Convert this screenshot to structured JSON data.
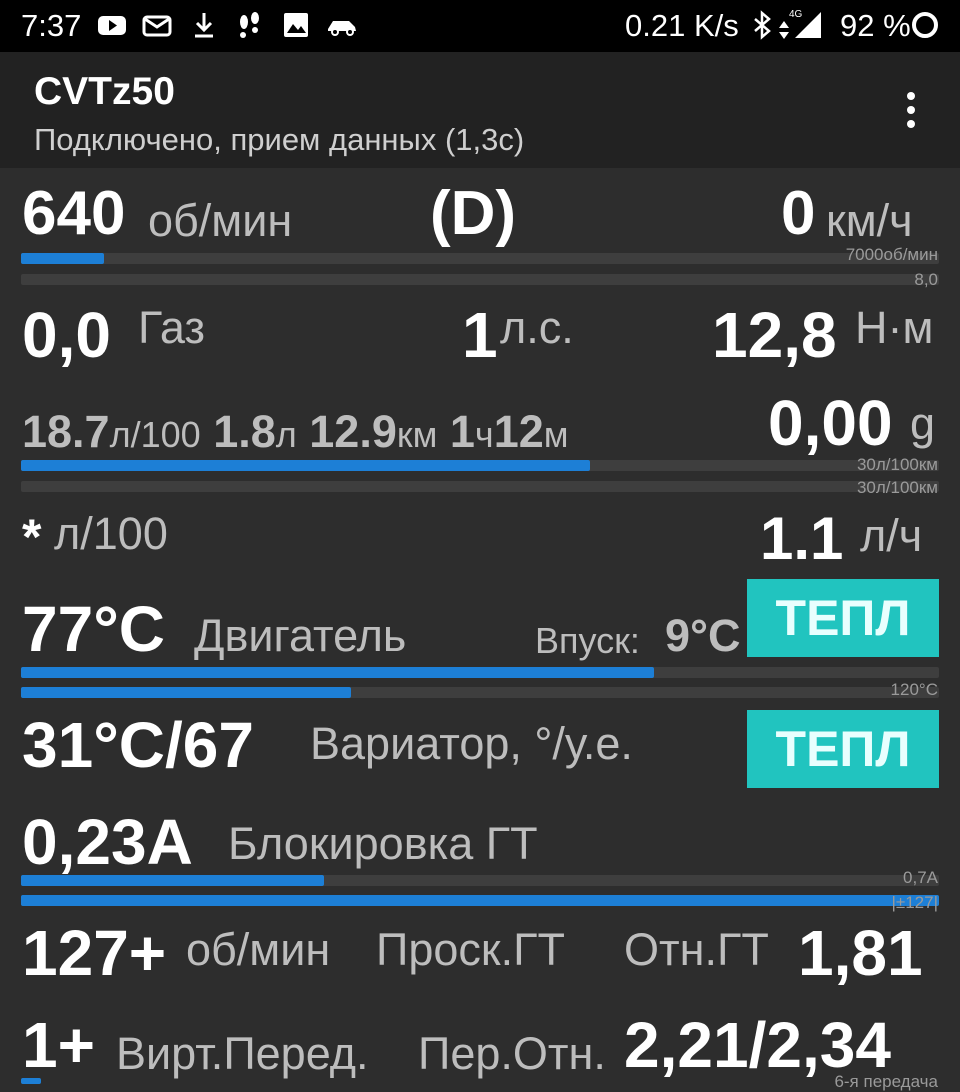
{
  "status_bar": {
    "time": "7:37",
    "net_speed": "0.21 K/s",
    "network": "4G",
    "battery": "92 %",
    "icons": [
      "youtube-icon",
      "mail-icon",
      "download-icon",
      "steps-icon",
      "image-icon",
      "car-icon",
      "bluetooth-icon",
      "signal-icon",
      "battery-icon"
    ]
  },
  "app_bar": {
    "title": "CVTz50",
    "subtitle": "Подключено, прием данных (1,3с)",
    "menu_icon": "overflow-menu-icon"
  },
  "row1": {
    "rpm_value": "640",
    "rpm_unit": "об/мин",
    "gear": "(D)",
    "speed_value": "0",
    "speed_unit": "км/ч",
    "rpm_scale": "7000об/мин",
    "speed_scale": "8,0",
    "rpm_fill": 0.09,
    "speed_fill": 0.0
  },
  "row2": {
    "throttle_value": "0,0",
    "throttle_label": "Газ",
    "power_value": "1",
    "power_unit": "л.с.",
    "torque_value": "12,8",
    "torque_unit": "Н·м"
  },
  "row3": {
    "cons_value": "18.7",
    "cons_unit": "л/100",
    "fuel_value": "1.8",
    "fuel_unit": "л",
    "dist_value": "12.9",
    "dist_unit": "км",
    "time_h": "1",
    "time_h_unit": "ч",
    "time_m": "12",
    "time_m_unit": "м",
    "g_value": "0,00",
    "g_unit": "g",
    "scale1": "30л/100км",
    "scale2": "30л/100км",
    "fill1": 0.62,
    "fill2": 0.0
  },
  "row4": {
    "inst_value": "*",
    "inst_unit": "л/100",
    "hourly_value": "1.1",
    "hourly_unit": "л/ч"
  },
  "row5": {
    "engine_temp": "77°C",
    "engine_label": "Двигатель",
    "intake_label": "Впуск:",
    "intake_value": "9°C",
    "button": "ТЕПЛ",
    "scale": "120°C",
    "fill1": 0.69,
    "fill2": 0.36
  },
  "row6": {
    "cvt_value": "31°C/67",
    "cvt_label": "Вариатор, °/у.е.",
    "button": "ТЕПЛ"
  },
  "row7": {
    "lock_value": "0,23A",
    "lock_label": "Блокировка ГТ",
    "scale1": "0,7A",
    "scale2": "|±127|",
    "fill1": 0.33,
    "fill2": 1.0
  },
  "row8": {
    "slip_value": "127+",
    "slip_unit": "об/мин",
    "slip_label": "Проск.ГТ",
    "ratio_label": "Отн.ГТ",
    "ratio_value": "1,81"
  },
  "row9": {
    "vgear_value": "1+",
    "vgear_label": "Вирт.Перед.",
    "per_label": "Пер.Отн.",
    "per_value": "2,21/2,34",
    "scale": "6-я передача"
  },
  "colors": {
    "background": "#2d2d2d",
    "bar_fill": "#1d7fd6",
    "button": "#21c4bf"
  }
}
